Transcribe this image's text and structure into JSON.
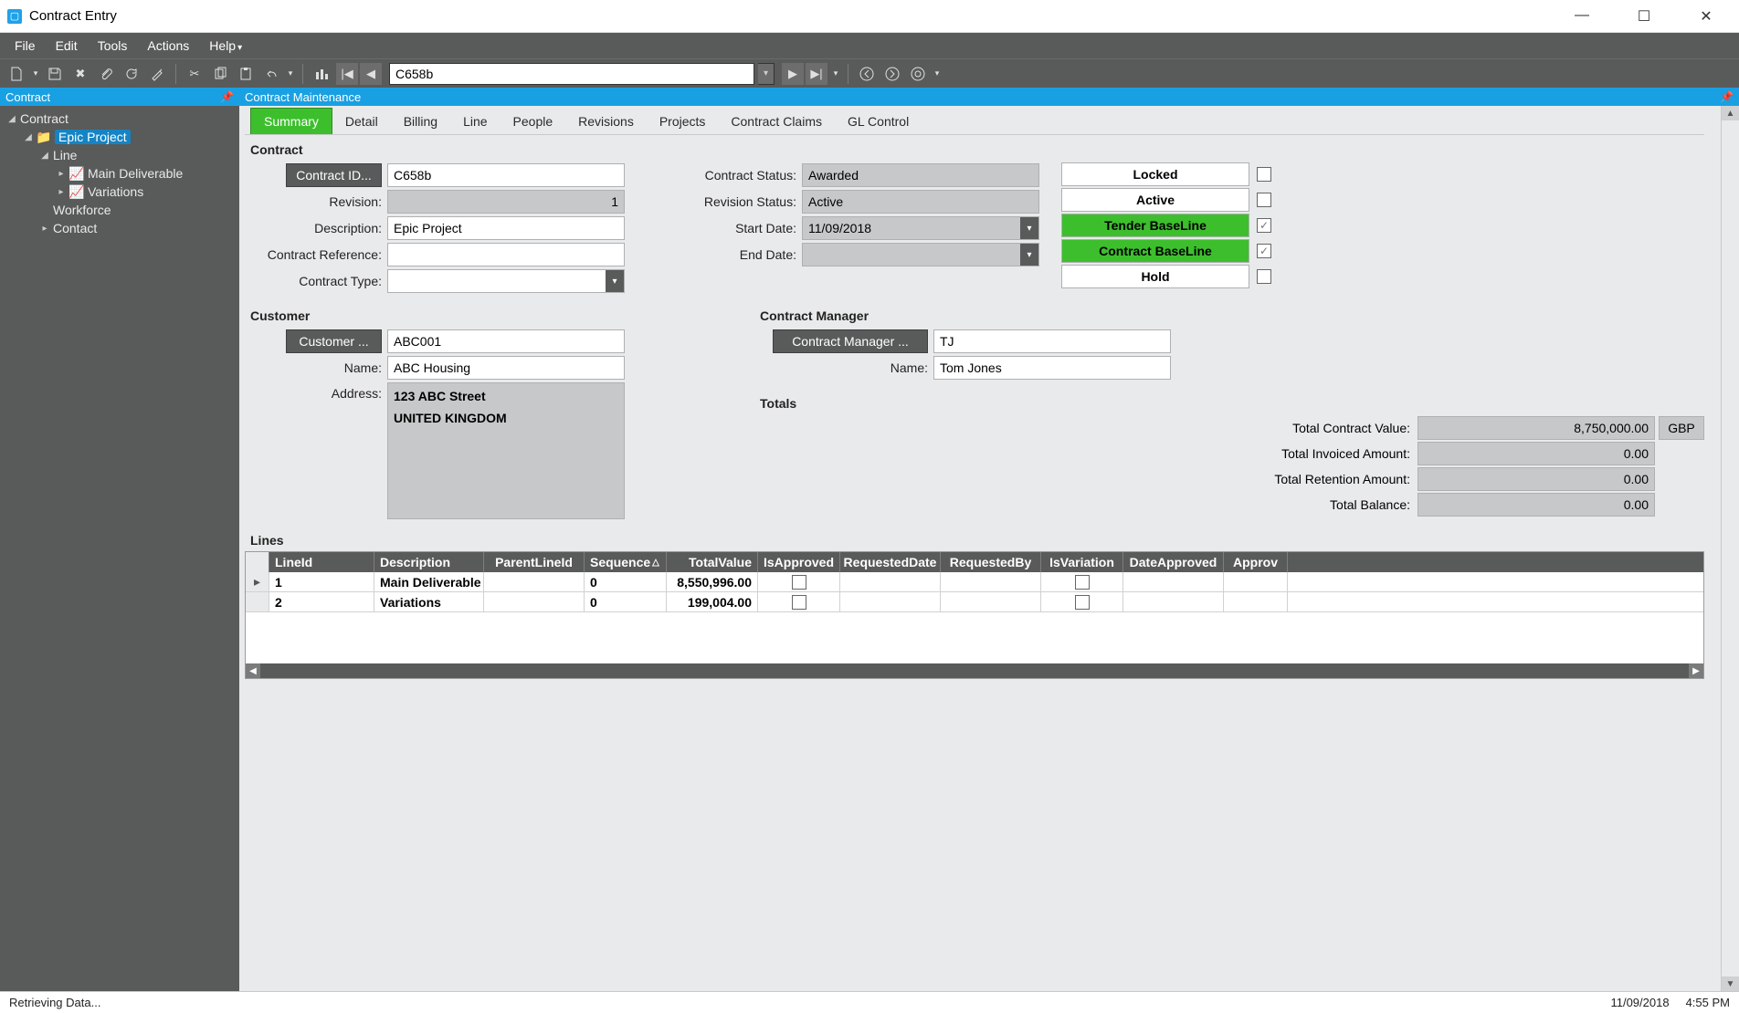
{
  "window": {
    "title": "Contract Entry"
  },
  "menu": [
    "File",
    "Edit",
    "Tools",
    "Actions",
    "Help"
  ],
  "toolbar": {
    "search_value": "C658b"
  },
  "panels": {
    "left_title": "Contract",
    "right_title": "Contract Maintenance"
  },
  "tree": {
    "root": "Contract",
    "project": "Epic Project",
    "line": "Line",
    "children": [
      "Main Deliverable",
      "Variations"
    ],
    "workforce": "Workforce",
    "contact": "Contact"
  },
  "tabs": [
    "Summary",
    "Detail",
    "Billing",
    "Line",
    "People",
    "Revisions",
    "Projects",
    "Contract Claims",
    "GL Control"
  ],
  "contract": {
    "section": "Contract",
    "id_button": "Contract ID...",
    "id_value": "C658b",
    "revision_label": "Revision:",
    "revision_value": "1",
    "desc_label": "Description:",
    "desc_value": "Epic Project",
    "ref_label": "Contract Reference:",
    "ref_value": "",
    "type_label": "Contract Type:",
    "type_value": "",
    "status_label": "Contract Status:",
    "status_value": "Awarded",
    "revstatus_label": "Revision Status:",
    "revstatus_value": "Active",
    "start_label": "Start Date:",
    "start_value": "11/09/2018",
    "end_label": "End Date:",
    "end_value": ""
  },
  "flags": {
    "locked": "Locked",
    "active": "Active",
    "tender_baseline": "Tender BaseLine",
    "contract_baseline": "Contract BaseLine",
    "hold": "Hold"
  },
  "customer": {
    "section": "Customer",
    "button": "Customer ...",
    "code": "ABC001",
    "name_label": "Name:",
    "name_value": "ABC Housing",
    "addr_label": "Address:",
    "addr_line1": "123 ABC Street",
    "addr_line2": "UNITED KINGDOM"
  },
  "manager": {
    "section": "Contract Manager",
    "button": "Contract Manager ...",
    "code": "TJ",
    "name_label": "Name:",
    "name_value": "Tom Jones"
  },
  "totals": {
    "section": "Totals",
    "contract_value_label": "Total Contract Value:",
    "contract_value": "8,750,000.00",
    "currency": "GBP",
    "invoiced_label": "Total Invoiced Amount:",
    "invoiced": "0.00",
    "retention_label": "Total Retention Amount:",
    "retention": "0.00",
    "balance_label": "Total Balance:",
    "balance": "0.00"
  },
  "lines": {
    "section": "Lines",
    "headers": [
      "LineId",
      "Description",
      "ParentLineId",
      "Sequence",
      "TotalValue",
      "IsApproved",
      "RequestedDate",
      "RequestedBy",
      "IsVariation",
      "DateApproved",
      "Approv"
    ],
    "rows": [
      {
        "LineId": "1",
        "Description": "Main Deliverable",
        "ParentLineId": "",
        "Sequence": "0",
        "TotalValue": "8,550,996.00",
        "IsApproved": false,
        "RequestedDate": "",
        "RequestedBy": "",
        "IsVariation": false,
        "DateApproved": ""
      },
      {
        "LineId": "2",
        "Description": "Variations",
        "ParentLineId": "",
        "Sequence": "0",
        "TotalValue": "199,004.00",
        "IsApproved": false,
        "RequestedDate": "",
        "RequestedBy": "",
        "IsVariation": false,
        "DateApproved": ""
      }
    ]
  },
  "statusbar": {
    "message": "Retrieving Data...",
    "date": "11/09/2018",
    "time": "4:55 PM"
  }
}
